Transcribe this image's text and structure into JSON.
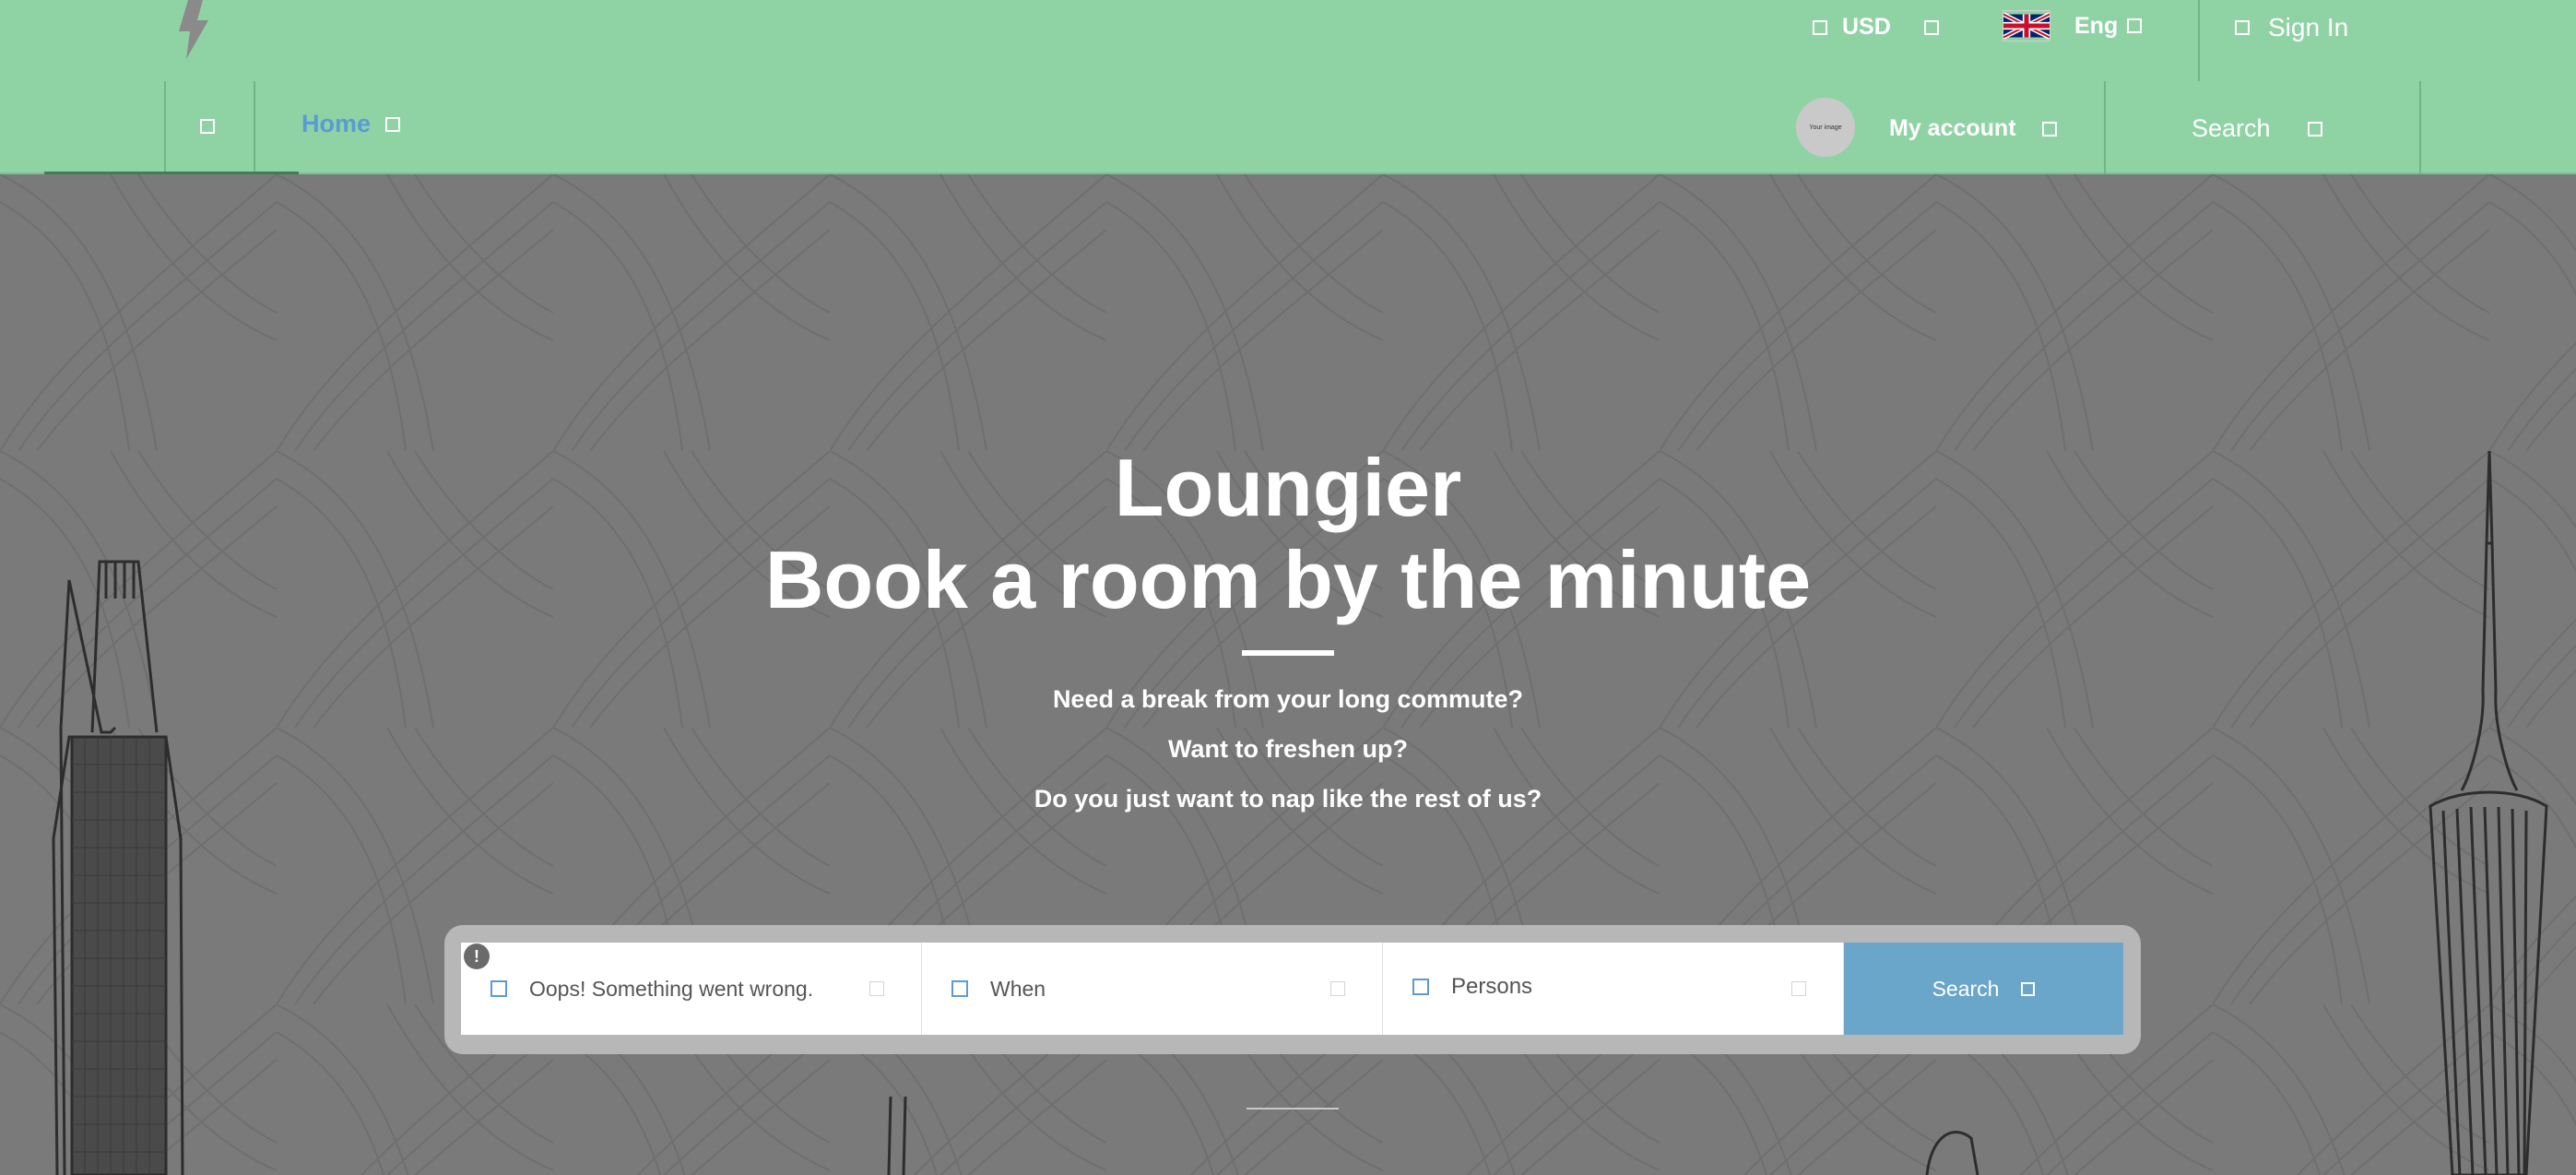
{
  "header": {
    "currency": "USD",
    "language": "Eng",
    "sign_in": "Sign In",
    "nav_home": "Home",
    "avatar_text": "Your image",
    "my_account": "My account",
    "search": "Search"
  },
  "hero": {
    "title_line1": "Loungier",
    "title_line2": "Book a room by the minute",
    "lines": [
      "Need a break from your long commute?",
      "Want to freshen up?",
      "Do you just want to nap like the rest of us?"
    ]
  },
  "search_form": {
    "location_error": "Oops! Something went wrong.",
    "error_icon": "!",
    "when_placeholder": "When",
    "persons_placeholder": "Persons",
    "submit_label": "Search"
  },
  "colors": {
    "header_bg": "#8fd3a5",
    "link_blue": "#5b9bd5",
    "button_blue": "#6aa6c9",
    "hero_bg": "#7a7a7a"
  },
  "icons": [
    "lightning-bolt-logo-icon",
    "uk-flag-icon",
    "placeholder-square-icon",
    "error-alert-icon"
  ]
}
